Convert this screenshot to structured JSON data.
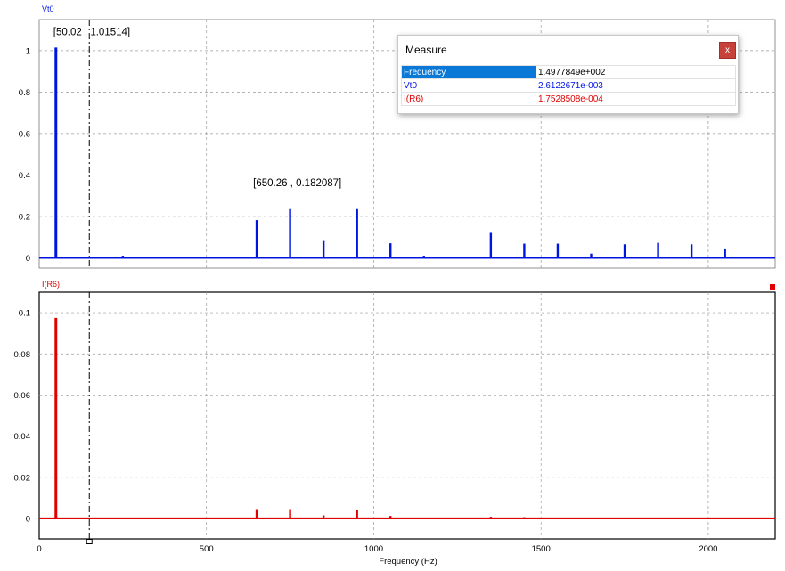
{
  "colors": {
    "vt0": "#0014e0",
    "ir6": "#e00000",
    "grid": "#9a9a9a",
    "selection": "#0a78d7"
  },
  "chart_data": [
    {
      "type": "line",
      "name": "Vt0",
      "title": "Vt0",
      "xlim": [
        0,
        2200
      ],
      "ylim": [
        -0.05,
        1.15
      ],
      "xticks": [
        0,
        500,
        1000,
        1500,
        2000
      ],
      "yticks": [
        0,
        0.2,
        0.4,
        0.6,
        0.8,
        1
      ],
      "ytick_labels": [
        "0",
        "0.2",
        "0.4",
        "0.6",
        "0.8",
        "1"
      ],
      "grid": true,
      "peaks": [
        {
          "x": 50,
          "y": 1.015
        },
        {
          "x": 250,
          "y": 0.01
        },
        {
          "x": 350,
          "y": 0.006
        },
        {
          "x": 450,
          "y": 0.006
        },
        {
          "x": 550,
          "y": 0.006
        },
        {
          "x": 650,
          "y": 0.182
        },
        {
          "x": 750,
          "y": 0.235
        },
        {
          "x": 850,
          "y": 0.085
        },
        {
          "x": 950,
          "y": 0.235
        },
        {
          "x": 1050,
          "y": 0.07
        },
        {
          "x": 1150,
          "y": 0.01
        },
        {
          "x": 1350,
          "y": 0.12
        },
        {
          "x": 1450,
          "y": 0.068
        },
        {
          "x": 1550,
          "y": 0.068
        },
        {
          "x": 1650,
          "y": 0.02
        },
        {
          "x": 1750,
          "y": 0.065
        },
        {
          "x": 1850,
          "y": 0.072
        },
        {
          "x": 1950,
          "y": 0.065
        },
        {
          "x": 2050,
          "y": 0.045
        }
      ],
      "annotations": [
        {
          "x": 50.02,
          "y": 1.01514,
          "text": "[50.02 , 1.01514]"
        },
        {
          "x": 650.26,
          "y": 0.182087,
          "text": "[650.26 , 0.182087]"
        }
      ]
    },
    {
      "type": "line",
      "name": "I(R6)",
      "title": "I(R6)",
      "xlabel": "Frequency (Hz)",
      "xlim": [
        0,
        2200
      ],
      "ylim": [
        -0.01,
        0.11
      ],
      "xticks": [
        0,
        500,
        1000,
        1500,
        2000
      ],
      "xtick_labels": [
        "0",
        "500",
        "1000",
        "1500",
        "2000"
      ],
      "yticks": [
        0,
        0.02,
        0.04,
        0.06,
        0.08,
        0.1
      ],
      "ytick_labels": [
        "0",
        "0.02",
        "0.04",
        "0.06",
        "0.08",
        "0.1"
      ],
      "grid": true,
      "peaks": [
        {
          "x": 50,
          "y": 0.0975
        },
        {
          "x": 650,
          "y": 0.0045
        },
        {
          "x": 750,
          "y": 0.0045
        },
        {
          "x": 850,
          "y": 0.0015
        },
        {
          "x": 950,
          "y": 0.004
        },
        {
          "x": 1050,
          "y": 0.0012
        },
        {
          "x": 1350,
          "y": 0.0008
        },
        {
          "x": 1450,
          "y": 0.0006
        },
        {
          "x": 1550,
          "y": 0.0004
        },
        {
          "x": 1750,
          "y": 0.0003
        },
        {
          "x": 1850,
          "y": 0.0003
        },
        {
          "x": 1950,
          "y": 0.0003
        },
        {
          "x": 2050,
          "y": 0.0002
        }
      ]
    }
  ],
  "cursor": {
    "frequency": 149.77849
  },
  "measure": {
    "title": "Measure",
    "close_label": "x",
    "rows": [
      {
        "label": "Frequency",
        "value": "1.4977849e+002",
        "color": "#000000"
      },
      {
        "label": "Vt0",
        "value": "2.6122671e-003",
        "color": "#0014e0"
      },
      {
        "label": "I(R6)",
        "value": "1.7528508e-004",
        "color": "#e00000"
      }
    ]
  }
}
